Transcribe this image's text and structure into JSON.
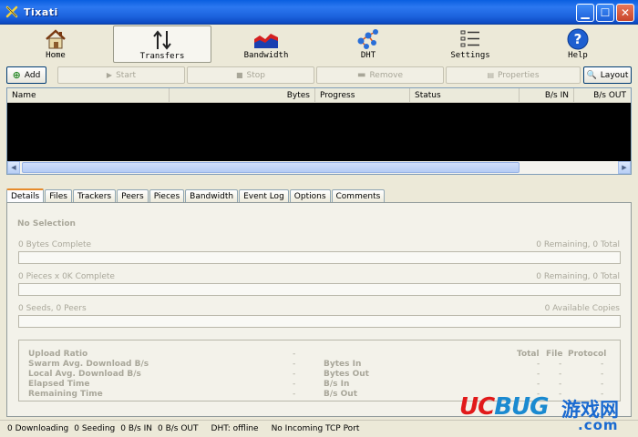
{
  "window": {
    "title": "Tixati"
  },
  "toolbar": [
    {
      "label": "Home",
      "icon": "home-icon"
    },
    {
      "label": "Transfers",
      "icon": "transfers-icon",
      "active": true
    },
    {
      "label": "Bandwidth",
      "icon": "bandwidth-icon"
    },
    {
      "label": "DHT",
      "icon": "dht-icon"
    },
    {
      "label": "Settings",
      "icon": "settings-icon"
    },
    {
      "label": "Help",
      "icon": "help-icon"
    }
  ],
  "actions": {
    "add": "Add",
    "start": "Start",
    "stop": "Stop",
    "remove": "Remove",
    "properties": "Properties",
    "layout": "Layout"
  },
  "list": {
    "columns": [
      "Name",
      "Bytes",
      "Progress",
      "Status",
      "B/s IN",
      "B/s OUT"
    ]
  },
  "tabs": [
    "Details",
    "Files",
    "Trackers",
    "Peers",
    "Pieces",
    "Bandwidth",
    "Event Log",
    "Options",
    "Comments"
  ],
  "details": {
    "selection": "No Selection",
    "bytes_complete": "0 Bytes Complete",
    "bytes_remaining": "0 Remaining,  0 Total",
    "pieces_complete": "0 Pieces  x  0K Complete",
    "pieces_remaining": "0 Remaining,  0 Total",
    "seeds_peers": "0 Seeds, 0 Peers",
    "available_copies": "0 Available Copies",
    "stats_left": [
      "Upload Ratio",
      "Swarm Avg. Download B/s",
      "Local Avg. Download B/s",
      "Elapsed Time",
      "Remaining Time"
    ],
    "stats_right": [
      "Bytes In",
      "Bytes Out",
      "B/s In",
      "B/s Out"
    ],
    "dash": "-",
    "stats_headers": [
      "Total",
      "File",
      "Protocol"
    ]
  },
  "status": {
    "downloading": "0 Downloading",
    "seeding": "0 Seeding",
    "bs_in": "0 B/s IN",
    "bs_out": "0 B/s OUT",
    "dht": "DHT: offline",
    "tcp": "No Incoming TCP Port"
  },
  "watermark": {
    "uc": "UC",
    "bug": "BUG",
    "cn": "游戏网",
    "com": ".com"
  }
}
